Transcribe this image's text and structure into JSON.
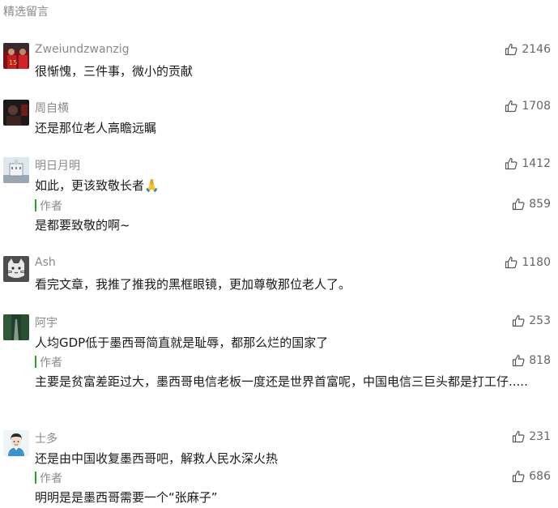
{
  "section_title": "精选留言",
  "colors": {
    "author_bar": "#1aad19",
    "nick": "#8a8a8a",
    "text": "#1a1a1a",
    "likes": "#666666"
  },
  "author_label": "作者",
  "comments": [
    {
      "nickname": "Zweiundzwanzig",
      "likes": "2146",
      "text": "很惭愧，三件事，微小的贡献",
      "avatar_icon": "football-player-avatar"
    },
    {
      "nickname": "周自横",
      "likes": "1708",
      "text": "还是那位老人高瞻远瞩",
      "avatar_icon": "dark-photo-avatar"
    },
    {
      "nickname": "明日月明",
      "likes": "1412",
      "text": "如此，更该致敬长者🙏",
      "avatar_icon": "building-avatar",
      "reply": {
        "text": "是都要致敬的啊~",
        "likes": "859"
      }
    },
    {
      "nickname": "Ash",
      "likes": "1180",
      "text": "看完文章，我推了推我的黑框眼镜，更加尊敬那位老人了。",
      "avatar_icon": "cat-avatar"
    },
    {
      "nickname": "阿宇",
      "likes": "253",
      "text": "人均GDP低于墨西哥简直就是耻辱，都那么烂的国家了",
      "avatar_icon": "forest-road-avatar",
      "reply": {
        "text": "主要是贫富差距过大，墨西哥电信老板一度还是世界首富呢，中国电信三巨头都是打工仔.....",
        "likes": "818"
      }
    },
    {
      "nickname": "士多",
      "likes": "231",
      "text": "还是由中国收复墨西哥吧，解救人民水深火热",
      "avatar_icon": "cartoon-man-avatar",
      "reply": {
        "text": "明明是是墨西哥需要一个“张麻子”",
        "likes": "686"
      }
    }
  ]
}
